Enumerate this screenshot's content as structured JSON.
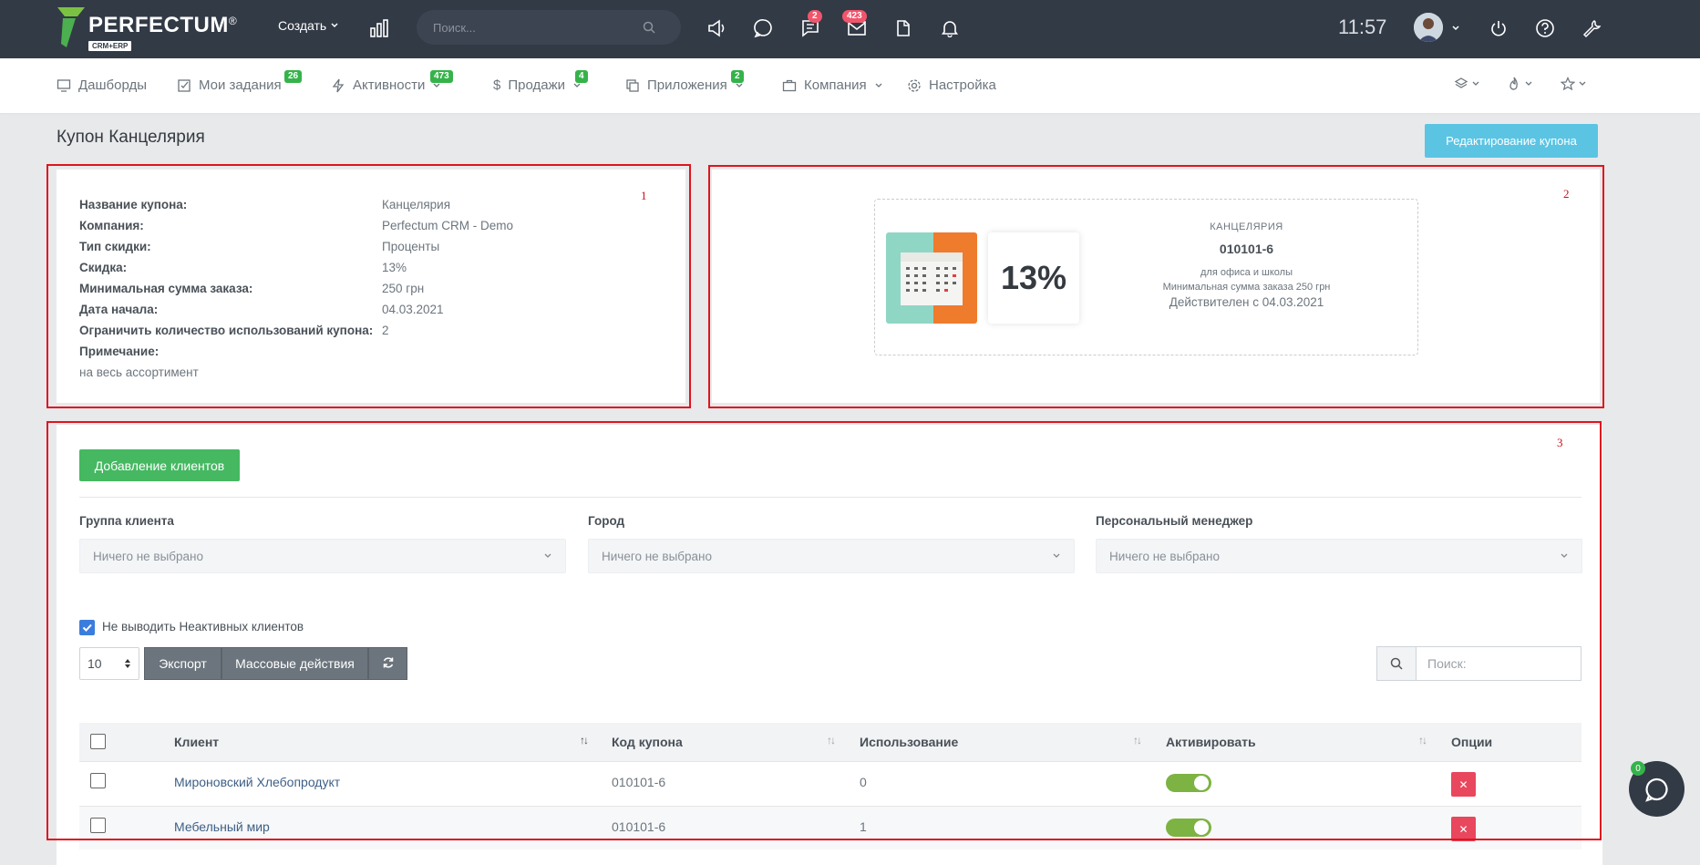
{
  "brand": {
    "name": "PERFECTUM",
    "reg": "®",
    "sub": "CRM+ERP"
  },
  "topbar": {
    "create_label": "Создать",
    "search_placeholder": "Поиск...",
    "chat_badge": "2",
    "mail_badge": "423",
    "clock": "11:57"
  },
  "menu": {
    "items": [
      {
        "label": "Дашборды",
        "icon": "monitor-icon"
      },
      {
        "label": "Мои задания",
        "icon": "checkbox-icon",
        "badge": "26"
      },
      {
        "label": "Активности",
        "icon": "bolt-icon",
        "badge": "473"
      },
      {
        "label": "Продажи",
        "icon": "dollar-icon",
        "badge": "4"
      },
      {
        "label": "Приложения",
        "icon": "copy-icon",
        "badge": "2"
      },
      {
        "label": "Компания",
        "icon": "briefcase-icon"
      },
      {
        "label": "Настройка",
        "icon": "gear-icon"
      }
    ]
  },
  "page": {
    "title": "Купон Канцелярия",
    "edit_button": "Редактирование купона"
  },
  "annotations": {
    "box1": "1",
    "box2": "2",
    "box3": "3"
  },
  "coupon_info": {
    "rows": [
      {
        "label": "Название купона:",
        "value": "Канцелярия"
      },
      {
        "label": "Компания:",
        "value": "Perfectum CRM - Demo"
      },
      {
        "label": "Тип скидки:",
        "value": "Проценты"
      },
      {
        "label": "Скидка:",
        "value": "13%"
      },
      {
        "label": "Минимальная сумма заказа:",
        "value": "250 грн"
      },
      {
        "label": "Дата начала:",
        "value": "04.03.2021"
      },
      {
        "label": "Ограничить количество использований купона:",
        "value": "2"
      },
      {
        "label": "Примечание:",
        "value": ""
      }
    ],
    "note": "на весь ассортимент"
  },
  "coupon_card": {
    "percent": "13%",
    "name": "КАНЦЕЛЯРИЯ",
    "code": "010101-6",
    "description": "для офиса и школы",
    "min_sum": "Минимальная сумма заказа 250 грн",
    "valid_from": "Действителен с 04.03.2021"
  },
  "clients": {
    "add_button": "Добавление клиентов",
    "filters": [
      {
        "label": "Группа клиента",
        "value": "Ничего не выбрано"
      },
      {
        "label": "Город",
        "value": "Ничего не выбрано"
      },
      {
        "label": "Персональный менеджер",
        "value": "Ничего не выбрано"
      }
    ],
    "hide_inactive_label": "Не выводить Неактивных клиентов",
    "page_length": "10",
    "export_button": "Экспорт",
    "bulk_button": "Массовые действия",
    "search_placeholder": "Поиск:",
    "columns": [
      "Клиент",
      "Код купона",
      "Использование",
      "Активировать",
      "Опции"
    ],
    "rows": [
      {
        "client": "Мироновский Хлебопродукт",
        "code": "010101-6",
        "usage": "0",
        "active": true
      },
      {
        "client": "Мебельный мир",
        "code": "010101-6",
        "usage": "1",
        "active": true
      }
    ]
  },
  "chat_widget": {
    "badge": "0"
  },
  "colors": {
    "topbar": "#323a46",
    "accent_green": "#45b861",
    "info_blue": "#5bc4e3",
    "danger": "#e8475e",
    "annotation_red": "#e0141e"
  }
}
